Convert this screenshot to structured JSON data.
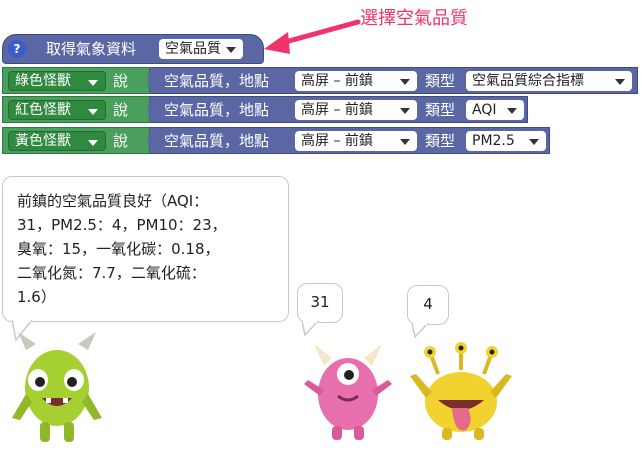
{
  "annotation": {
    "text": "選擇空氣品質"
  },
  "hat_block": {
    "help_icon_text": "?",
    "title": "取得氣象資料",
    "dropdown_value": "空氣品質"
  },
  "say_blocks": [
    {
      "monster": "綠色怪獸",
      "verb": "說",
      "text": "空氣品質，地點",
      "location": "高屏 – 前鎮",
      "type_label": "類型",
      "type_value": "空氣品質綜合指標"
    },
    {
      "monster": "紅色怪獸",
      "verb": "說",
      "text": "空氣品質，地點",
      "location": "高屏 – 前鎮",
      "type_label": "類型",
      "type_value": "AQI"
    },
    {
      "monster": "黃色怪獸",
      "verb": "說",
      "text": "空氣品質，地點",
      "location": "高屏 – 前鎮",
      "type_label": "類型",
      "type_value": "PM2.5"
    }
  ],
  "bubbles": {
    "green_lines": [
      "前鎮的空氣品質良好（AQI：",
      "31，PM2.5：4，PM10：23，",
      "臭氧：15，一氧化碳：0.18，",
      "二氧化氮：7.7，二氧化硫：",
      "1.6）"
    ],
    "pink": "31",
    "yellow": "4"
  },
  "colors": {
    "blue_block": "#5b67a5",
    "green_block": "#4a9f5c",
    "annotation": "#f0336a",
    "green_monster": "#a6cf32",
    "pink_monster": "#e86fae",
    "yellow_monster": "#f2d22e"
  }
}
